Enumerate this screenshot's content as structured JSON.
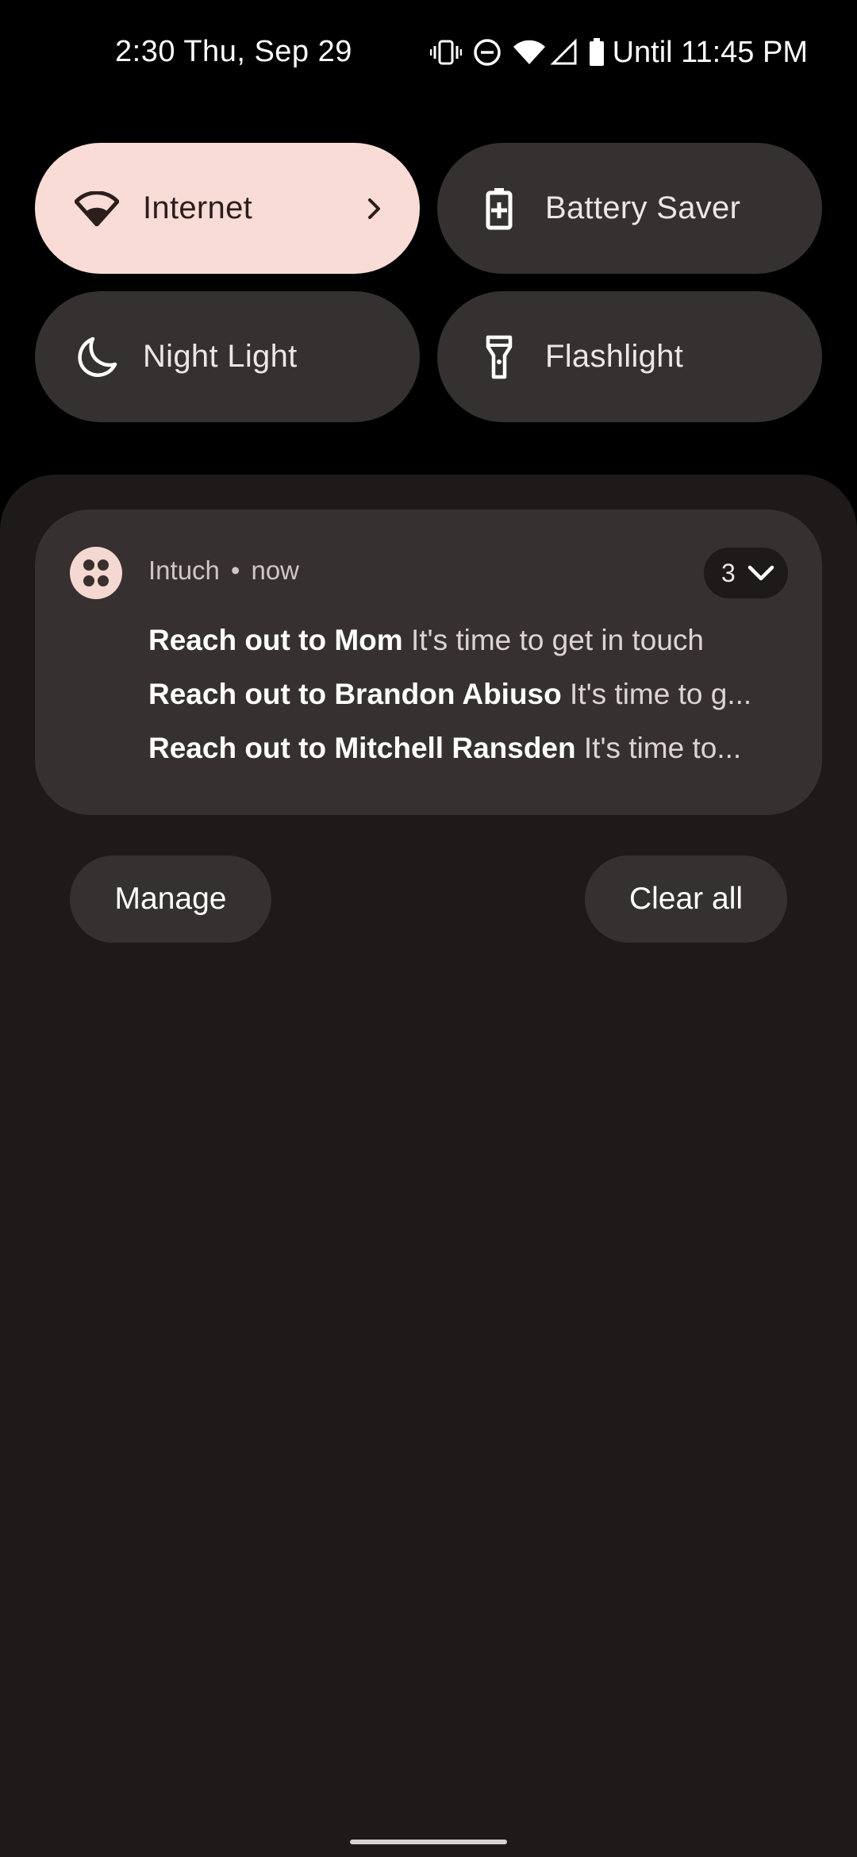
{
  "status_bar": {
    "time": "2:30",
    "date": "Thu, Sep 29",
    "until": "Until 11:45 PM",
    "icons": [
      "vibrate-icon",
      "do-not-disturb-icon",
      "wifi-icon",
      "cellular-signal-icon",
      "battery-icon"
    ]
  },
  "quick_tiles": [
    {
      "label": "Internet",
      "icon": "wifi-icon",
      "active": true,
      "has_chevron": true
    },
    {
      "label": "Battery Saver",
      "icon": "battery-saver-icon",
      "active": false
    },
    {
      "label": "Night Light",
      "icon": "moon-icon",
      "active": false
    },
    {
      "label": "Flashlight",
      "icon": "flashlight-icon",
      "active": false
    }
  ],
  "notification": {
    "app_name": "Intuch",
    "separator": "•",
    "time": "now",
    "count": "3",
    "items": [
      {
        "title": "Reach out to Mom",
        "text": "It's time to get in touch"
      },
      {
        "title": "Reach out to Brandon Abiuso",
        "text": "It's time to g..."
      },
      {
        "title": "Reach out to Mitchell Ransden",
        "text": "It's time to..."
      }
    ]
  },
  "actions": {
    "manage": "Manage",
    "clear_all": "Clear all"
  },
  "colors": {
    "active_tile": "#f9dcd6",
    "tile": "#353130",
    "sheet": "#1f1a1a",
    "card": "#363130"
  }
}
